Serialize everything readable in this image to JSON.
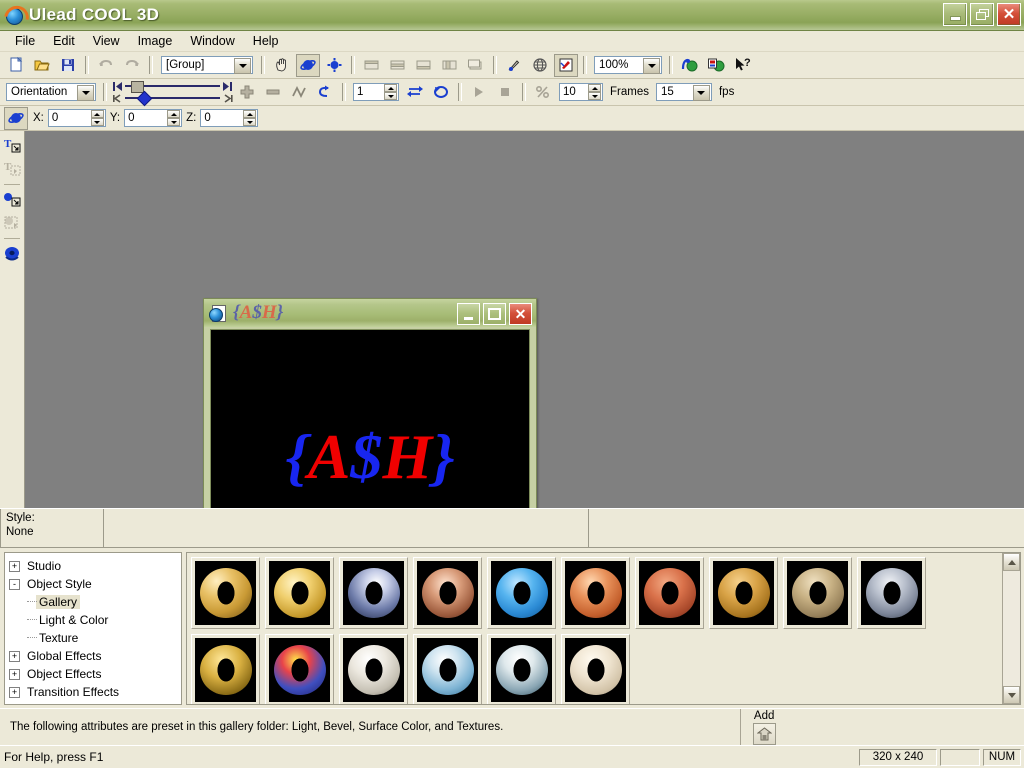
{
  "window": {
    "app_title": "Ulead COOL 3D",
    "app_icon": "ulead-globe-icon",
    "buttons": {
      "minimize": "minimize-icon",
      "restore": "restore-icon",
      "close": "close-icon"
    }
  },
  "menu": {
    "items": [
      {
        "label": "File"
      },
      {
        "label": "Edit"
      },
      {
        "label": "View"
      },
      {
        "label": "Image"
      },
      {
        "label": "Window"
      },
      {
        "label": "Help"
      }
    ]
  },
  "toolbar_standard": {
    "group_selector_value": "[Group]",
    "zoom_value": "100%",
    "buttons": [
      {
        "name": "new-file-button",
        "icon": "new-page-icon"
      },
      {
        "name": "open-file-button",
        "icon": "open-folder-icon"
      },
      {
        "name": "save-file-button",
        "icon": "floppy-disk-icon"
      },
      {
        "name": "undo-button",
        "icon": "undo-arrow-icon"
      },
      {
        "name": "redo-button",
        "icon": "redo-arrow-icon"
      },
      {
        "name": "pan-tool-button",
        "icon": "hand-icon"
      },
      {
        "name": "rotate-object-button",
        "icon": "rotate-globe-icon"
      },
      {
        "name": "move-object-button",
        "icon": "move-object-icon"
      },
      {
        "name": "align-left-button",
        "icon": "align-left-icon"
      },
      {
        "name": "align-center-button",
        "icon": "align-center-icon"
      },
      {
        "name": "align-right-button",
        "icon": "align-right-icon"
      },
      {
        "name": "distribute-button",
        "icon": "distribute-icon"
      },
      {
        "name": "group-button",
        "icon": "group-icon"
      },
      {
        "name": "color-picker-button",
        "icon": "eyedropper-icon"
      },
      {
        "name": "web-preview-button",
        "icon": "globe-grid-icon"
      },
      {
        "name": "edit-mode-button",
        "icon": "pencil-box-icon"
      },
      {
        "name": "export-image-button",
        "icon": "export-image-icon"
      },
      {
        "name": "export-animation-button",
        "icon": "export-animation-icon"
      },
      {
        "name": "context-help-button",
        "icon": "arrow-question-icon"
      }
    ]
  },
  "toolbar_animation": {
    "mode_value": "Orientation",
    "frame_value": "1",
    "speed_value": "10",
    "frames_label": "Frames",
    "frames_value": "15",
    "fps_label": "fps",
    "buttons": [
      {
        "name": "first-keyframe-button",
        "icon": "step-back-icon"
      },
      {
        "name": "last-keyframe-button",
        "icon": "step-forward-icon"
      },
      {
        "name": "add-keyframe-button",
        "icon": "plus-icon"
      },
      {
        "name": "remove-keyframe-button",
        "icon": "minus-icon"
      },
      {
        "name": "smooth-keyframe-button",
        "icon": "curve-icon"
      },
      {
        "name": "loop-button",
        "icon": "loop-arrow-icon"
      },
      {
        "name": "reverse-playback-button",
        "icon": "reverse-icon"
      },
      {
        "name": "cycle-button",
        "icon": "cycle-icon"
      },
      {
        "name": "play-button",
        "icon": "play-triangle-icon"
      },
      {
        "name": "stop-button",
        "icon": "stop-square-icon"
      },
      {
        "name": "no-speed-button",
        "icon": "percent-slash-icon"
      }
    ]
  },
  "toolbar_position": {
    "tool_icon": "rotate-globe-icon",
    "x_label": "X:",
    "x_value": "0",
    "y_label": "Y:",
    "y_value": "0",
    "z_label": "Z:",
    "z_value": "0"
  },
  "left_tools": [
    {
      "name": "insert-text-button",
      "icon": "text-insert-icon",
      "enabled": true
    },
    {
      "name": "edit-text-button",
      "icon": "text-edit-icon",
      "enabled": false
    },
    {
      "name": "insert-object-button",
      "icon": "object-insert-icon",
      "enabled": true
    },
    {
      "name": "edit-object-button",
      "icon": "object-edit-icon",
      "enabled": false
    },
    {
      "name": "view-object-button",
      "icon": "torus-view-icon",
      "enabled": true
    }
  ],
  "document": {
    "title_parts": [
      {
        "text": "{",
        "color": "blue"
      },
      {
        "text": "A",
        "color": "red"
      },
      {
        "text": "$",
        "color": "blue"
      },
      {
        "text": "H",
        "color": "red"
      },
      {
        "text": "}",
        "color": "blue"
      }
    ],
    "icon": "document-3d-icon",
    "buttons": {
      "minimize": "minimize-icon",
      "maximize": "maximize-icon",
      "close": "close-icon"
    },
    "canvas_background": "#000000",
    "canvas_text_colors": {
      "brace": "#1826f0",
      "letter": "#f00000"
    }
  },
  "style_bar": {
    "label": "Style:",
    "value": "None"
  },
  "tree": {
    "nodes": [
      {
        "label": "Studio",
        "expander": "+",
        "level": 0,
        "selected": false
      },
      {
        "label": "Object Style",
        "expander": "-",
        "level": 0,
        "selected": false
      },
      {
        "label": "Gallery",
        "expander": "",
        "level": 1,
        "selected": true
      },
      {
        "label": "Light & Color",
        "expander": "",
        "level": 1,
        "selected": false
      },
      {
        "label": "Texture",
        "expander": "",
        "level": 1,
        "selected": false
      },
      {
        "label": "Global Effects",
        "expander": "+",
        "level": 0,
        "selected": false
      },
      {
        "label": "Object Effects",
        "expander": "+",
        "level": 0,
        "selected": false
      },
      {
        "label": "Transition Effects",
        "expander": "+",
        "level": 0,
        "selected": false
      }
    ]
  },
  "gallery": {
    "thumbnails": [
      {
        "name": "gold-smooth-torus",
        "style": "radial-gradient(circle at 32% 26%, #ffeec0 0%, #e8c065 32%, #c99a35 62%, #6d4e12 100%)"
      },
      {
        "name": "gold-ridged-torus",
        "style": "radial-gradient(circle at 38% 30%, #fff3c4 0%, #f0cf6e 35%, #c79b2c 70%, #7a5a14 100%)"
      },
      {
        "name": "chrome-blue-torus",
        "style": "radial-gradient(circle at 55% 30%, #ffffff 0%, #c8cfe8 25%, #6c7aa8 60%, #1b2340 100%)"
      },
      {
        "name": "copper-ring-torus",
        "style": "radial-gradient(circle at 45% 32%, #ffe3cf 0%, #d79a78 35%, #9c5a3c 70%, #4a2216 100%)"
      },
      {
        "name": "blue-studded-torus",
        "style": "radial-gradient(circle at 40% 30%, #bfe6ff 0%, #56b4ef 35%, #2b8ad4 65%, #10538c 100%)"
      },
      {
        "name": "orange-swirl-torus",
        "style": "radial-gradient(circle at 40% 28%, #ffd7b0 0%, #e8915a 35%, #c45f2c 70%, #6b2d10 100%)"
      },
      {
        "name": "terracotta-carved-torus",
        "style": "radial-gradient(circle at 42% 30%, #f2a882 0%, #d9714a 38%, #a8482a 72%, #5a2212 100%)"
      },
      {
        "name": "amber-beaded-torus",
        "style": "radial-gradient(circle at 40% 28%, #f5d08a 0%, #d8a246 38%, #a8751f 72%, #543808 100%)"
      },
      {
        "name": "stone-cobble-torus",
        "style": "radial-gradient(circle at 42% 28%, #efe0c0 0%, #c8b184 38%, #97815a 72%, #4c3e26 100%)"
      },
      {
        "name": "steel-plated-torus",
        "style": "radial-gradient(circle at 45% 30%, #f0f2f6 0%, #b8bfcc 35%, #7d8699 68%, #343b47 100%)"
      },
      {
        "name": "gold-nugget-torus",
        "style": "radial-gradient(circle at 42% 30%, #ffe89a 0%, #d9b041 40%, #8a6b16 75%, #241d06 100%)"
      },
      {
        "name": "rainbow-mosaic-torus",
        "style": "radial-gradient(circle at 42% 30%, #ffe24a 0%, #e8434a 30%, #3f4fc0 62%, #1c1f6a 100%)"
      },
      {
        "name": "white-marble-torus",
        "style": "radial-gradient(circle at 40% 28%, #ffffff 0%, #ece8df 35%, #c4bfb2 70%, #6e6a60 100%)"
      },
      {
        "name": "blue-sky-torus",
        "style": "radial-gradient(circle at 42% 30%, #ffffff 0%, #cfe4f0 30%, #7eb4d4 65%, #2f6b92 100%)"
      },
      {
        "name": "white-blue-swirl-torus",
        "style": "radial-gradient(circle at 44% 28%, #ffffff 0%, #dfe9ec 32%, #8aa6b4 68%, #2a4a58 100%)"
      },
      {
        "name": "ivory-matte-torus",
        "style": "radial-gradient(circle at 42% 30%, #fffaf0 0%, #efe4d0 38%, #d2c3a8 72%, #8d8270 100%)"
      }
    ],
    "scroll_up_icon": "scroll-up-arrow",
    "scroll_down_icon": "scroll-down-arrow"
  },
  "hint_bar": {
    "text": "The following attributes are preset in this gallery folder: Light, Bevel, Surface Color, and Textures.",
    "add_label": "Add",
    "add_icon": "add-gallery-icon"
  },
  "status_bar": {
    "help_text": "For Help, press F1",
    "dimensions": "320 x 240",
    "blank": "",
    "num_lock": "NUM"
  }
}
